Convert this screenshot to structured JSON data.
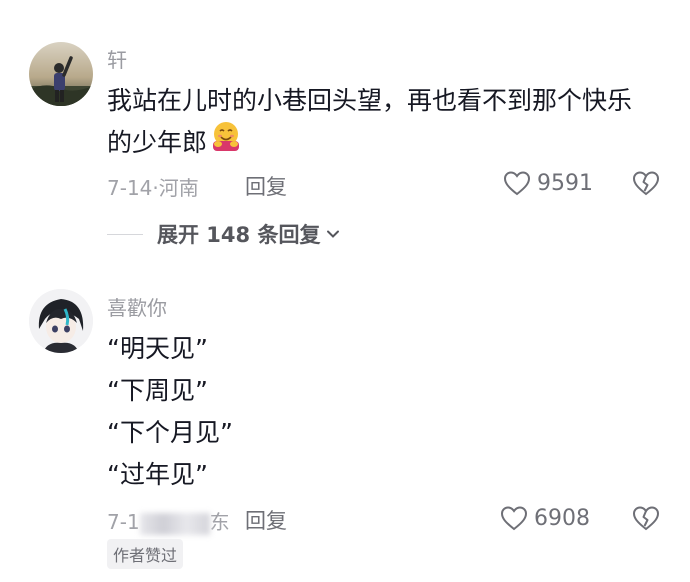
{
  "comments": [
    {
      "username": "轩",
      "text_line1": "我站在儿时的小巷回头望，再也看不到那个快乐",
      "text_line2": "的少年郎",
      "emoji_icon": "hugging-face-icon",
      "date": "7-14",
      "location": "河南",
      "reply_label": "回复",
      "likes": "9591",
      "expand_label": "展开 148 条回复"
    },
    {
      "username": "喜歡你",
      "lines": [
        "“明天见”",
        "“下周见”",
        "“下个月见”",
        "“过年见”"
      ],
      "date_prefix": "7-1",
      "location_suffix": "东",
      "reply_label": "回复",
      "likes": "6908",
      "author_badge": "作者赞过"
    }
  ],
  "colors": {
    "text": "#161823",
    "muted": "#a1a2a8",
    "icon": "#6e6f76"
  }
}
